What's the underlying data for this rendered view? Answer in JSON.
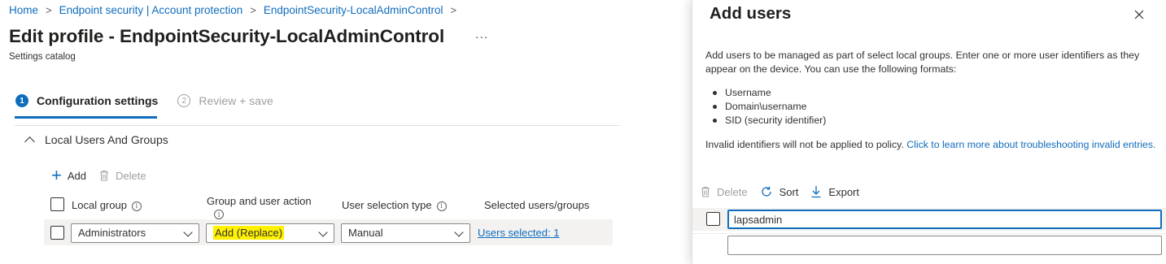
{
  "breadcrumb": {
    "items": [
      "Home",
      "Endpoint security | Account protection",
      "EndpointSecurity-LocalAdminControl"
    ],
    "separator": ">"
  },
  "page": {
    "title": "Edit profile - EndpointSecurity-LocalAdminControl",
    "more": "...",
    "subtitle": "Settings catalog"
  },
  "steps": [
    {
      "number": "1",
      "label": "Configuration settings",
      "active": true
    },
    {
      "number": "2",
      "label": "Review + save",
      "active": false
    }
  ],
  "section": {
    "title": "Local Users And Groups"
  },
  "commands": {
    "add": "Add",
    "delete": "Delete"
  },
  "table": {
    "headers": {
      "local_group": "Local group",
      "group_user_action": "Group and user action",
      "user_selection_type": "User selection type",
      "selected": "Selected users/groups"
    },
    "row": {
      "local_group": "Administrators",
      "group_user_action": "Add (Replace)",
      "user_selection_type": "Manual",
      "selected": "Users selected: 1"
    }
  },
  "panel": {
    "title": "Add users",
    "description": "Add users to be managed as part of select local groups. Enter one or more user identifiers as they appear on the device. You can use the following formats:",
    "formats": [
      "Username",
      "Domain\\username",
      "SID (security identifier)"
    ],
    "invalid_note": "Invalid identifiers will not be applied to policy.",
    "learn_more": "Click to learn more about troubleshooting invalid entries.",
    "commands": {
      "delete": "Delete",
      "sort": "Sort",
      "export": "Export"
    },
    "rows": [
      {
        "value": "lapsadmin"
      },
      {
        "value": ""
      }
    ]
  },
  "colors": {
    "accent": "#0f6cbd",
    "highlight": "#fff100",
    "row_bg": "#f3f2f1"
  }
}
